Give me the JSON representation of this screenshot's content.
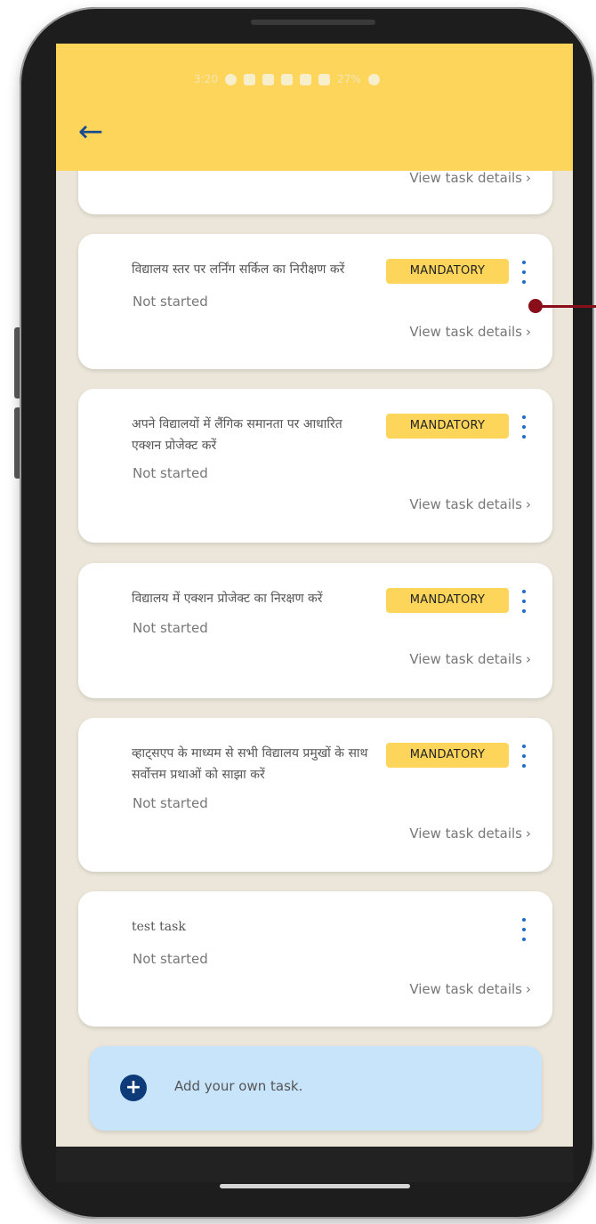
{
  "status_bar": {
    "time": "3:20",
    "battery": "27%"
  },
  "header": {
    "back_icon": "arrow-left-icon"
  },
  "tasks": [
    {
      "title": "",
      "status": "",
      "link": "View task details",
      "mandatory": false
    },
    {
      "title": "विद्यालय स्तर पर लर्निंग सर्किल का निरीक्षण करें",
      "status": "Not started",
      "badge": "MANDATORY",
      "link": "View task details"
    },
    {
      "title": "अपने विद्यालयों में लैंगिक समानता पर आधारित एक्शन प्रोजेक्ट करें",
      "status": "Not started",
      "badge": "MANDATORY",
      "link": "View task details"
    },
    {
      "title": "विद्यालय में एक्शन प्रोजेक्ट का निरक्षण करें",
      "status": "Not started",
      "badge": "MANDATORY",
      "link": "View task details"
    },
    {
      "title": "व्हाट्सएप के माध्यम से सभी विद्यालय प्रमुखों के साथ सर्वोत्तम प्रथाओं को साझा करें",
      "status": "Not started",
      "badge": "MANDATORY",
      "link": "View task details"
    },
    {
      "title": "test task",
      "status": "Not started",
      "link": "View task details"
    }
  ],
  "add_task": {
    "label": "Add your own task.",
    "icon": "plus-circle-icon"
  },
  "colors": {
    "header": "#fdd55b",
    "badge": "#fdd55b",
    "kebab": "#1e6dc6",
    "add_task_bg": "#c8e4fb",
    "plus_icon": "#0d3b7a"
  }
}
